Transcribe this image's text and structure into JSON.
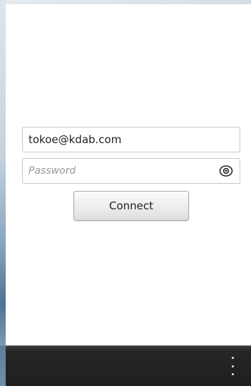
{
  "login_form": {
    "email_value": "tokoe@kdab.com",
    "password_placeholder": "Password",
    "password_value": "",
    "show_password_icon": "eye-icon",
    "connect_label": "Connect"
  },
  "action_bar": {
    "overflow_icon": "more-vertical-icon"
  },
  "colors": {
    "window_background": "#ffffff",
    "action_bar_background": "#1f1f1f",
    "field_border": "#c9c9c9",
    "placeholder_text": "#9a9a9a"
  }
}
